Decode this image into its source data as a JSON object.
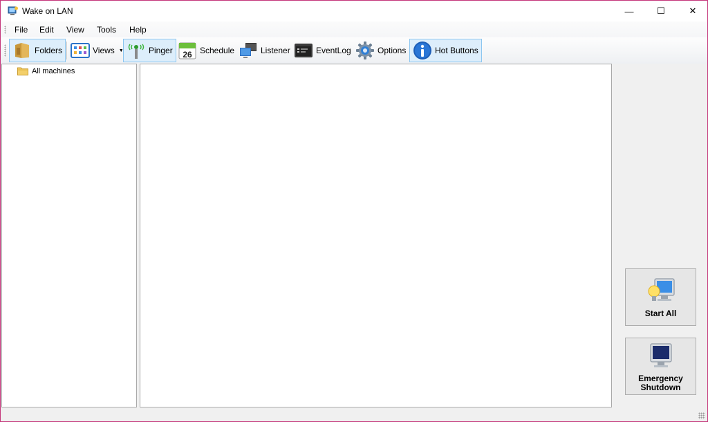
{
  "window": {
    "title": "Wake on LAN",
    "app_icon": "wake-on-lan-app-icon",
    "controls": {
      "minimize": "—",
      "maximize": "☐",
      "close": "✕"
    }
  },
  "menu": {
    "items": [
      {
        "label": "File"
      },
      {
        "label": "Edit"
      },
      {
        "label": "View"
      },
      {
        "label": "Tools"
      },
      {
        "label": "Help"
      }
    ]
  },
  "toolbar": {
    "buttons": [
      {
        "label": "Folders",
        "icon": "folders-icon",
        "active": true
      },
      {
        "label": "Views",
        "icon": "views-icon",
        "active": false,
        "dropdown": true
      },
      {
        "label": "Pinger",
        "icon": "pinger-antenna-icon",
        "active": true
      },
      {
        "label": "Schedule",
        "icon": "calendar-icon",
        "active": false,
        "badge": "26"
      },
      {
        "label": "Listener",
        "icon": "listener-monitors-icon",
        "active": false
      },
      {
        "label": "EventLog",
        "icon": "eventlog-terminal-icon",
        "active": false
      },
      {
        "label": "Options",
        "icon": "gear-icon",
        "active": false
      },
      {
        "label": "Hot Buttons",
        "icon": "info-icon",
        "active": true
      }
    ]
  },
  "tree": {
    "root": {
      "label": "All machines",
      "icon": "folder-icon"
    }
  },
  "side_buttons": {
    "start_all": {
      "label": "Start All",
      "icon": "monitor-bulb-icon"
    },
    "emergency": {
      "label_line1": "Emergency",
      "label_line2": "Shutdown",
      "icon": "monitor-off-icon"
    }
  },
  "colors": {
    "window_border": "#c4357a",
    "active_button_border": "#8cc6f0",
    "active_button_fill": "#ddeefb"
  }
}
